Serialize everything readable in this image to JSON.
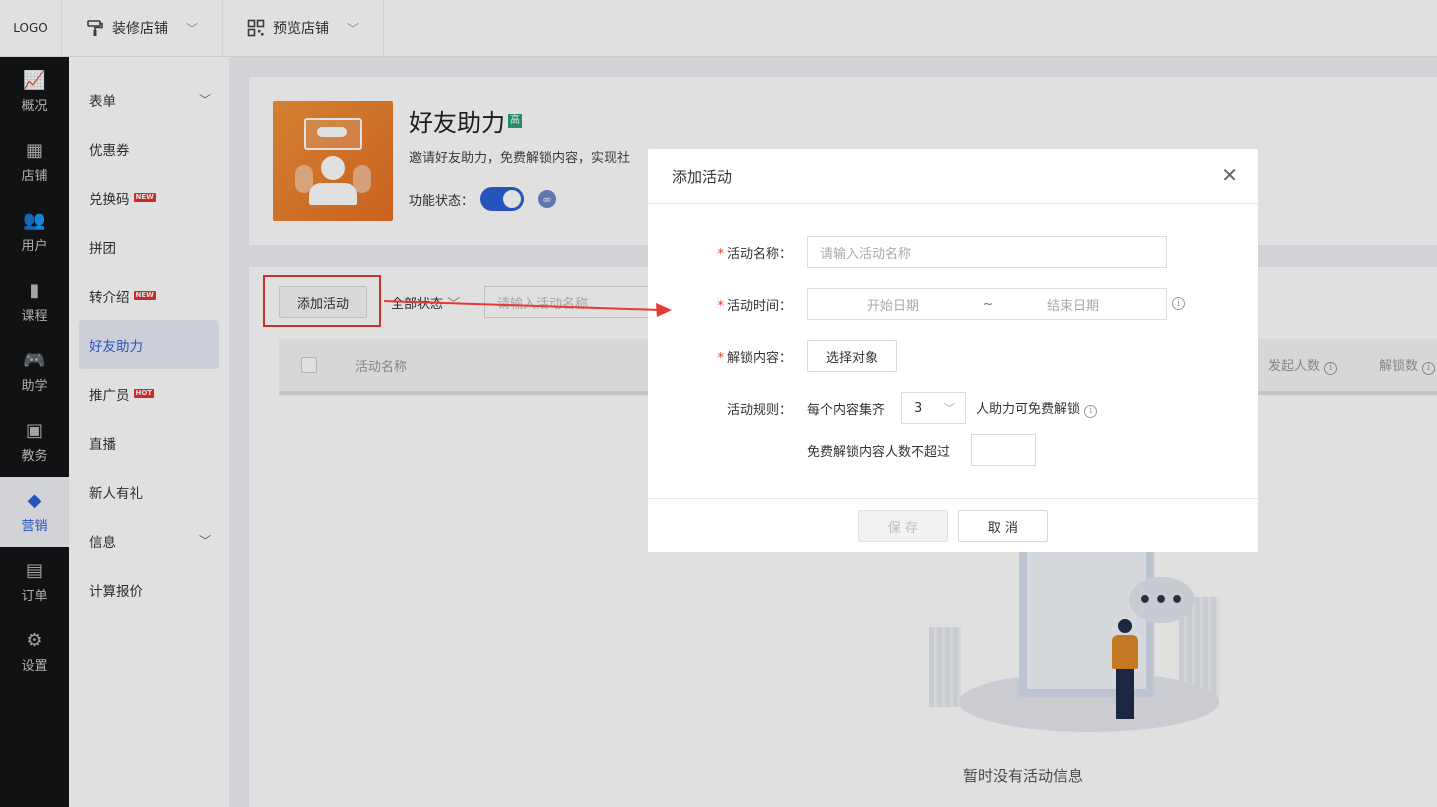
{
  "topbar": {
    "logo": "LOGO",
    "menus": [
      {
        "label": "装修店铺",
        "icon": "paint-roller-icon"
      },
      {
        "label": "预览店铺",
        "icon": "qrcode-icon"
      }
    ]
  },
  "sidebar": {
    "items": [
      {
        "label": "概况",
        "icon": "chart-icon"
      },
      {
        "label": "店铺",
        "icon": "store-icon"
      },
      {
        "label": "用户",
        "icon": "users-icon"
      },
      {
        "label": "课程",
        "icon": "book-icon"
      },
      {
        "label": "助学",
        "icon": "gamepad-icon"
      },
      {
        "label": "教务",
        "icon": "bookmark-icon"
      },
      {
        "label": "营销",
        "icon": "tag-icon"
      },
      {
        "label": "订单",
        "icon": "document-icon"
      },
      {
        "label": "设置",
        "icon": "gear-icon"
      }
    ],
    "active": "营销"
  },
  "subnav": {
    "items": [
      {
        "label": "表单"
      },
      {
        "label": "优惠券"
      },
      {
        "label": "兑换码",
        "tag": "NEW"
      },
      {
        "label": "拼团"
      },
      {
        "label": "转介绍",
        "tag": "NEW"
      },
      {
        "label": "好友助力"
      },
      {
        "label": "推广员",
        "tag": "HOT"
      },
      {
        "label": "直播"
      },
      {
        "label": "新人有礼"
      },
      {
        "label": "信息"
      },
      {
        "label": "计算报价"
      }
    ],
    "active": "好友助力"
  },
  "feature": {
    "title": "好友助力",
    "badge": "高",
    "desc": "邀请好友助力，免费解锁内容，实现社",
    "status_label": "功能状态：",
    "enabled": true
  },
  "list": {
    "add_button": "添加活动",
    "status_filter": "全部状态",
    "search_placeholder": "请输入活动名称",
    "columns": {
      "name": "活动名称",
      "initiators": "发起人数",
      "unlocks": "解锁数"
    },
    "empty_text": "暂时没有活动信息"
  },
  "modal": {
    "title": "添加活动",
    "close_icon": "close-icon",
    "fields": {
      "name_label": "活动名称：",
      "name_placeholder": "请输入活动名称",
      "time_label": "活动时间：",
      "start_placeholder": "开始日期",
      "separator": "~",
      "end_placeholder": "结束日期",
      "content_label": "解锁内容：",
      "select_button": "选择对象",
      "rule_label": "活动规则：",
      "rule_prefix": "每个内容集齐",
      "rule_count": "3",
      "rule_suffix": "人助力可免费解锁",
      "limit_label": "免费解锁内容人数不超过",
      "limit_value": ""
    },
    "save_button": "保 存",
    "cancel_button": "取 消"
  },
  "colors": {
    "primary": "#2c5fd6",
    "sidebar_bg": "#141517",
    "required": "#e83a35",
    "annotation": "#e83a35"
  }
}
